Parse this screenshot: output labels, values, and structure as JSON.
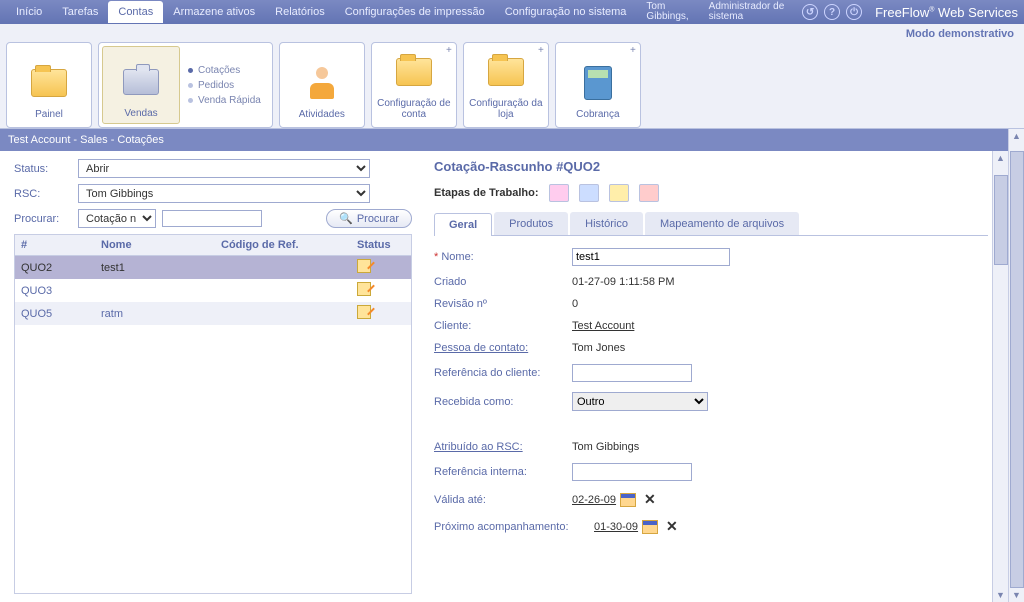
{
  "topbar": {
    "menu": [
      "Início",
      "Tarefas",
      "Contas",
      "Armazene ativos",
      "Relatórios",
      "Configurações de impressão",
      "Configuração no sistema"
    ],
    "active_index": 2,
    "user1_line1": "Tom",
    "user1_line2": "Gibbings,",
    "user2_line1": "Administrador de",
    "user2_line2": "sistema",
    "brand": "FreeFlow",
    "brand_suffix": " Web Services"
  },
  "demo_label": "Modo demonstrativo",
  "ribbon": {
    "painel": "Painel",
    "vendas": "Vendas",
    "sub": {
      "cotacoes": "Cotações",
      "pedidos": "Pedidos",
      "venda_rapida": "Venda Rápida"
    },
    "atividades": "Atividades",
    "config_conta": "Configuração de conta",
    "config_loja": "Configuração da loja",
    "cobranca": "Cobrança"
  },
  "breadcrumb": "Test Account - Sales - Cotações",
  "filters": {
    "status_label": "Status:",
    "status_value": "Abrir",
    "rsc_label": "RSC:",
    "rsc_value": "Tom Gibbings",
    "procurar_label": "Procurar:",
    "search_by_value": "Cotação nº",
    "search_btn": "Procurar"
  },
  "grid": {
    "headers": {
      "id": "#",
      "nome": "Nome",
      "codigo": "Código de Ref.",
      "status": "Status"
    },
    "rows": [
      {
        "id": "QUO2",
        "nome": "test1",
        "codigo": "",
        "selected": true
      },
      {
        "id": "QUO3",
        "nome": "",
        "codigo": ""
      },
      {
        "id": "QUO5",
        "nome": "ratm",
        "codigo": ""
      }
    ]
  },
  "quote": {
    "title": "Cotação-Rascunho #QUO2",
    "stages_label": "Etapas de Trabalho:",
    "tabs": [
      "Geral",
      "Produtos",
      "Histórico",
      "Mapeamento de arquivos"
    ],
    "active_tab": 0,
    "fields": {
      "nome_label": "Nome:",
      "nome_value": "test1",
      "criado_label": "Criado",
      "criado_value": "01-27-09 1:11:58 PM",
      "revisao_label": "Revisão nº",
      "revisao_value": "0",
      "cliente_label": "Cliente:",
      "cliente_value": "Test Account",
      "pessoa_label": "Pessoa de contato:",
      "pessoa_value": "Tom Jones",
      "refcli_label": "Referência do cliente:",
      "refcli_value": "",
      "recebida_label": "Recebida como:",
      "recebida_value": "Outro",
      "atrib_label": "Atribuído ao RSC:",
      "atrib_value": "Tom Gibbings",
      "refint_label": "Referência interna:",
      "refint_value": "",
      "valida_label": "Válida até:",
      "valida_value": "02-26-09",
      "prox_label": "Próximo acompanhamento:",
      "prox_value": "01-30-09"
    }
  }
}
